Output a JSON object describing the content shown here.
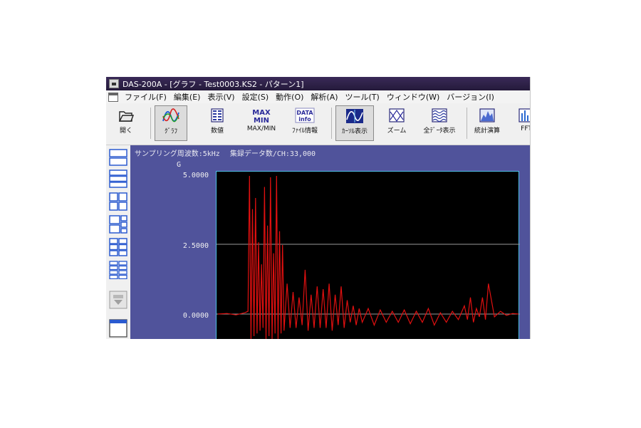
{
  "window": {
    "title": "DAS-200A - [グラフ - Test0003.KS2 - パターン1]"
  },
  "menu": [
    "ファイル(F)",
    "編集(E)",
    "表示(V)",
    "設定(S)",
    "動作(O)",
    "解析(A)",
    "ツール(T)",
    "ウィンドウ(W)",
    "バージョン(I)"
  ],
  "toolbar": {
    "open": "開く",
    "graph": "ｸﾞﾗﾌ",
    "numeric": "数値",
    "maxmin": "MAX/MIN",
    "maxmin_icon_top": "MAX",
    "maxmin_icon_bottom": "MIN",
    "fileinfo": "ﾌｧｲﾙ情報",
    "fileinfo_icon_top": "DATA",
    "fileinfo_icon_bottom": "info",
    "cursor": "ｶｰｿﾙ表示",
    "zoom": "ズーム",
    "alldata": "全ﾃﾞｰﾀ表示",
    "stats": "統計演算",
    "fft": "FFT"
  },
  "status": {
    "sampling": "サンプリング周波数:5kHz",
    "count": "集録データ数/CH:33,000"
  },
  "graph": {
    "unit": "G",
    "ticks": [
      "5.0000",
      "2.5000",
      "0.0000"
    ],
    "colors": {
      "background": "#50539b",
      "plot": "#000000",
      "trace": "#e01010",
      "gridline": "#9a9a9a",
      "frame": "#4fc0e8"
    }
  },
  "chart_data": {
    "type": "line",
    "ylabel": "G",
    "ylim": [
      -1.0,
      5.0
    ],
    "y_ticks": [
      0.0,
      2.5,
      5.0
    ],
    "series": [
      {
        "x": [
          0,
          0.03,
          0.06,
          0.09,
          0.1,
          0.105,
          0.11,
          0.115,
          0.12,
          0.125,
          0.13,
          0.135,
          0.14,
          0.145,
          0.15,
          0.155,
          0.16,
          0.165,
          0.17,
          0.175,
          0.18,
          0.185,
          0.19,
          0.195,
          0.2,
          0.205,
          0.21,
          0.215,
          0.22,
          0.23,
          0.24,
          0.25,
          0.26,
          0.27,
          0.28,
          0.29,
          0.3,
          0.31,
          0.32,
          0.33,
          0.34,
          0.35,
          0.36,
          0.37,
          0.38,
          0.39,
          0.4,
          0.41,
          0.42,
          0.43,
          0.44,
          0.45,
          0.46,
          0.47,
          0.48,
          0.5,
          0.52,
          0.54,
          0.56,
          0.58,
          0.6,
          0.62,
          0.64,
          0.66,
          0.68,
          0.7,
          0.72,
          0.74,
          0.76,
          0.78,
          0.8,
          0.82,
          0.83,
          0.84,
          0.85,
          0.86,
          0.87,
          0.88,
          0.89,
          0.9,
          0.92,
          0.94,
          0.96,
          0.98,
          1.0
        ],
        "y": [
          0.0,
          0.02,
          -0.03,
          0.05,
          0.1,
          5.0,
          -0.9,
          3.8,
          -0.8,
          4.2,
          -0.7,
          2.6,
          -0.6,
          1.8,
          -0.5,
          4.6,
          -0.9,
          3.2,
          -0.8,
          4.95,
          -0.9,
          2.2,
          -0.7,
          5.0,
          -0.9,
          3.0,
          -0.7,
          2.5,
          -0.6,
          1.1,
          -0.5,
          0.8,
          -0.5,
          0.6,
          -0.4,
          1.6,
          -0.6,
          0.7,
          -0.5,
          1.0,
          -0.5,
          0.9,
          -0.5,
          1.1,
          -0.6,
          0.7,
          -0.4,
          1.0,
          -0.5,
          0.5,
          -0.3,
          0.3,
          -0.4,
          0.2,
          -0.3,
          0.2,
          -0.4,
          0.15,
          -0.3,
          0.1,
          -0.3,
          0.15,
          -0.35,
          0.1,
          -0.3,
          0.2,
          -0.4,
          0.05,
          -0.3,
          0.1,
          -0.2,
          0.3,
          -0.2,
          0.6,
          -0.3,
          0.2,
          -0.1,
          0.6,
          -0.2,
          1.1,
          -0.1,
          0.1,
          -0.05,
          0.02,
          0.0
        ]
      }
    ]
  }
}
